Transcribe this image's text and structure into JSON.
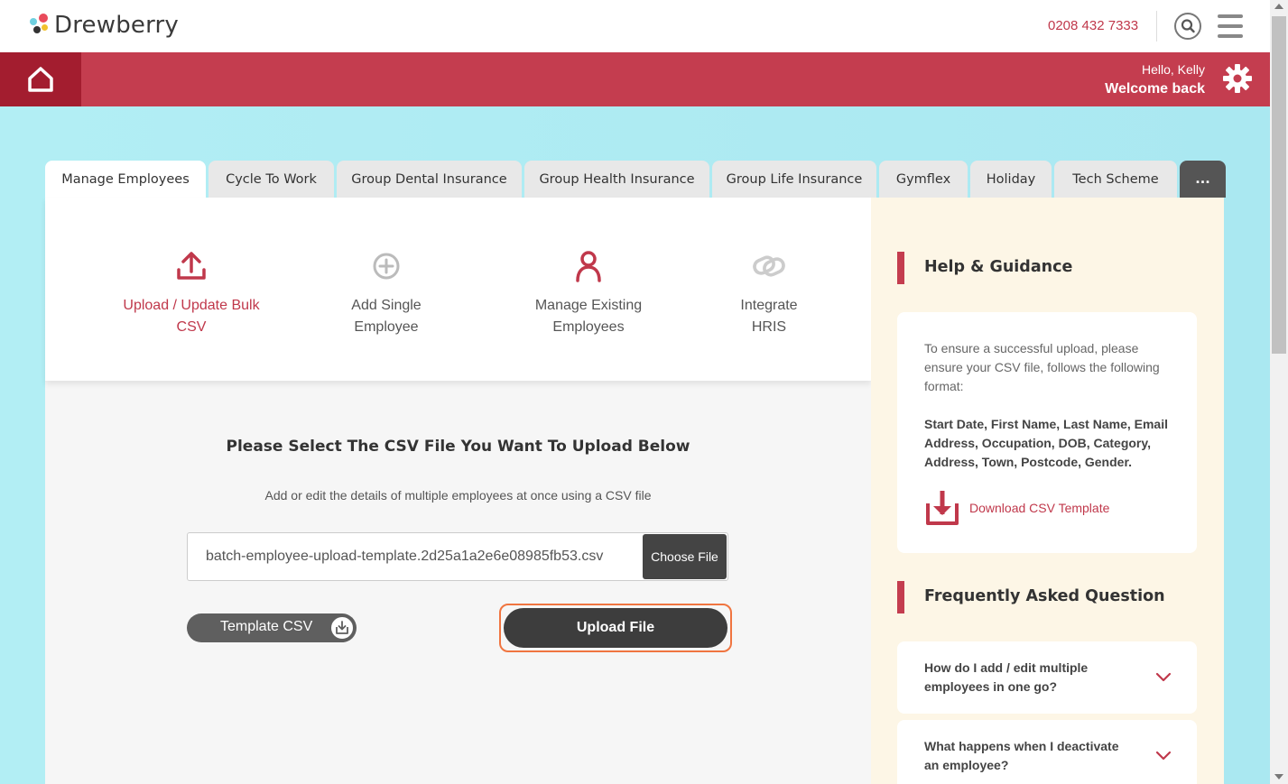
{
  "header": {
    "logo_text": "Drewberry",
    "phone": "0208 432 7333"
  },
  "banner": {
    "hello": "Hello, Kelly",
    "welcome": "Welcome back"
  },
  "tabs": [
    {
      "label": "Manage Employees",
      "active": true
    },
    {
      "label": "Cycle To Work"
    },
    {
      "label": "Group Dental Insurance"
    },
    {
      "label": "Group Health Insurance"
    },
    {
      "label": "Group Life Insurance"
    },
    {
      "label": "Gymflex"
    },
    {
      "label": "Holiday"
    },
    {
      "label": "Tech Scheme"
    },
    {
      "label": "..."
    }
  ],
  "options": [
    {
      "line1": "Upload / Update Bulk",
      "line2": "CSV",
      "icon": "upload-icon",
      "active": true
    },
    {
      "line1": "Add Single",
      "line2": "Employee",
      "icon": "plus-circle-icon"
    },
    {
      "line1": "Manage Existing",
      "line2": "Employees",
      "icon": "person-icon"
    },
    {
      "line1": "Integrate",
      "line2": "HRIS",
      "icon": "link-icon"
    }
  ],
  "upload": {
    "title": "Please Select The CSV File You Want To Upload Below",
    "subtitle": "Add or edit the details of multiple employees at once using a CSV file",
    "file_name": "batch-employee-upload-template.2d25a1a2e6e08985fb53.csv",
    "choose_label": "Choose File",
    "template_label": "Template CSV",
    "upload_label": "Upload File"
  },
  "help": {
    "title": "Help & Guidance",
    "intro": "To ensure a successful upload, please ensure your CSV file, follows the following format:",
    "format": "Start Date, First Name, Last Name, Email Address, Occupation, DOB, Category, Address, Town, Postcode, Gender.",
    "download_label": "Download CSV Template"
  },
  "faq": {
    "title": "Frequently Asked Question",
    "items": [
      "How do I add / edit multiple employees in one go?",
      "What happens when I deactivate an employee?"
    ]
  },
  "colors": {
    "brand_red": "#c43d4f",
    "dark_red": "#a31d2f",
    "background_cyan": "#b2eef4",
    "highlight_orange": "#f07540"
  }
}
